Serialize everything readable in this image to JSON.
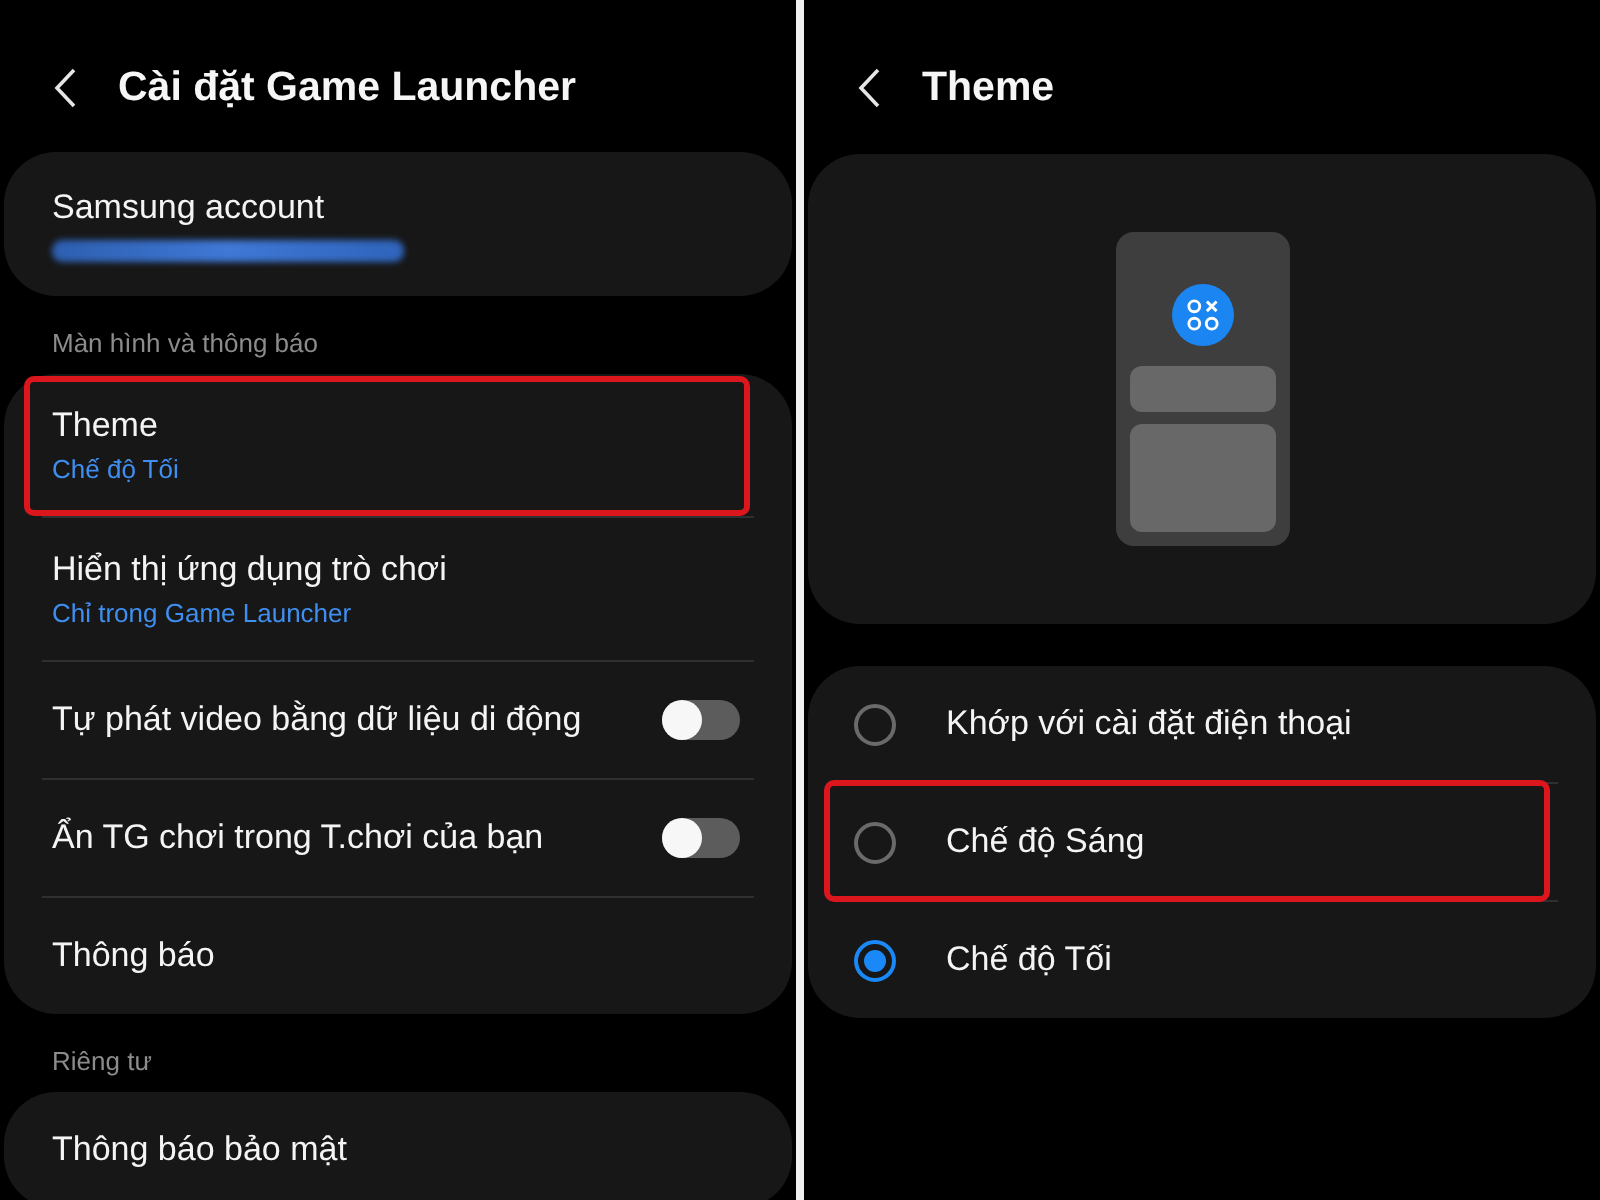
{
  "settings_screen": {
    "title": "Cài đặt Game Launcher",
    "account": {
      "title": "Samsung account",
      "email_blurred": true
    },
    "groups": [
      {
        "heading": "Màn hình và thông báo",
        "items": [
          {
            "kind": "link",
            "title": "Theme",
            "subtitle": "Chế độ Tối",
            "highlighted": true
          },
          {
            "kind": "link",
            "title": "Hiển thị ứng dụng trò chơi",
            "subtitle": "Chỉ trong Game Launcher",
            "highlighted": false
          },
          {
            "kind": "toggle",
            "title": "Tự phát video bằng dữ liệu di động",
            "on": false,
            "highlighted": false
          },
          {
            "kind": "toggle",
            "title": "Ẩn TG chơi trong T.chơi của bạn",
            "on": false,
            "highlighted": false
          },
          {
            "kind": "link",
            "title": "Thông báo",
            "highlighted": false
          }
        ]
      },
      {
        "heading": "Riêng tư",
        "items": [
          {
            "kind": "link",
            "title": "Thông báo bảo mật",
            "highlighted": false
          }
        ]
      }
    ]
  },
  "theme_screen": {
    "title": "Theme",
    "options": [
      {
        "label": "Khớp với cài đặt điện thoại",
        "selected": false,
        "highlighted": false
      },
      {
        "label": "Chế độ Sáng",
        "selected": false,
        "highlighted": true
      },
      {
        "label": "Chế độ Tối",
        "selected": true,
        "highlighted": false
      }
    ]
  }
}
